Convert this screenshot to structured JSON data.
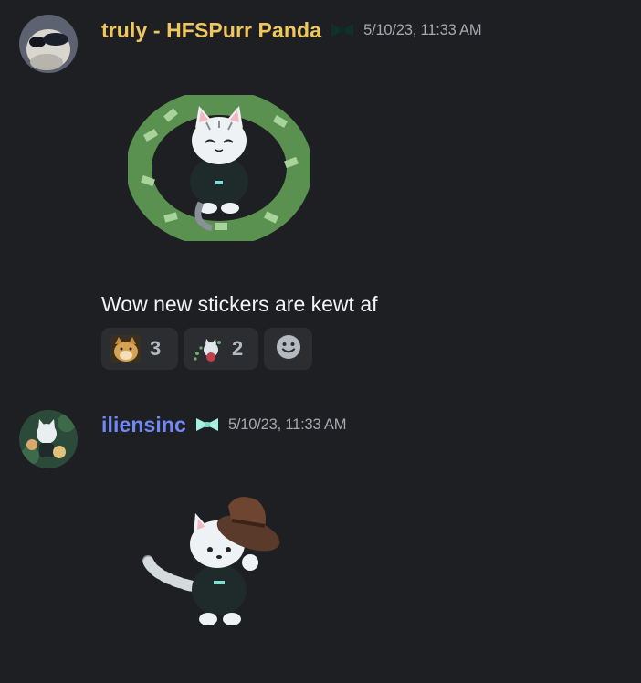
{
  "messages": [
    {
      "username": "truly - HFSPurr Panda",
      "username_color": "#f0c75e",
      "role_icon": "bow-tie-icon",
      "timestamp": "5/10/23, 11:33 AM",
      "sticker": "cat-money-wreath-sticker",
      "text": "Wow new stickers are kewt af",
      "reactions": [
        {
          "emoji": "doge-emoji",
          "count": "3"
        },
        {
          "emoji": "cat-party-emoji",
          "count": "2"
        }
      ],
      "add_reaction_icon": "smiley-icon"
    },
    {
      "username": "iliensinc",
      "username_color": "#7289f5",
      "role_icon": "bow-tie-icon",
      "timestamp": "5/10/23, 11:33 AM",
      "sticker": "cat-cowboy-hat-sticker"
    }
  ],
  "colors": {
    "background": "#1e1f22",
    "reaction_bg": "#2b2d31",
    "timestamp": "#a5a8ad",
    "text": "#f2f3f5"
  }
}
